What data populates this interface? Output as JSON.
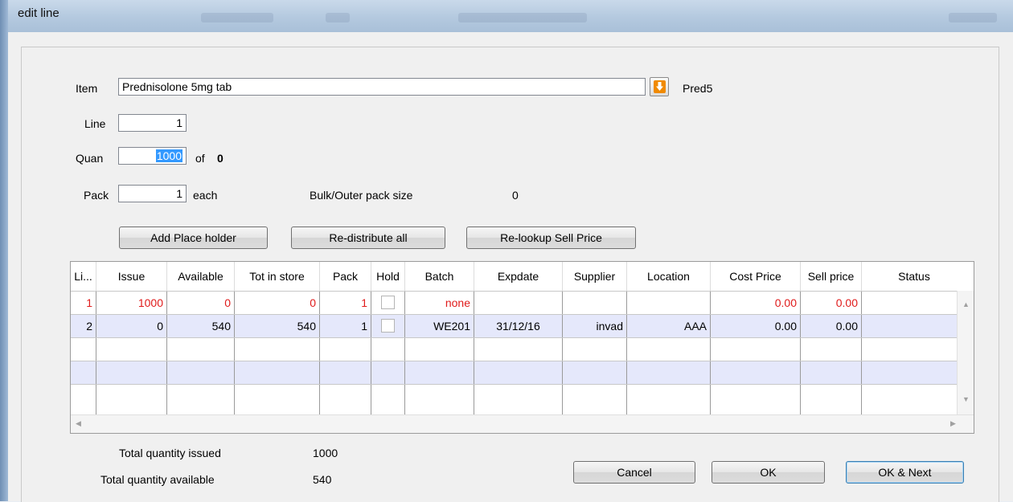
{
  "window": {
    "title": "edit line"
  },
  "form": {
    "item_label": "Item",
    "item_value": "Prednisolone 5mg tab",
    "item_code": "Pred5",
    "line_label": "Line",
    "line_value": "1",
    "quan_label": "Quan",
    "quan_value": "1000",
    "of_label": "of",
    "of_value": "0",
    "pack_label": "Pack",
    "pack_value": "1",
    "pack_unit": "each",
    "bulk_label": "Bulk/Outer pack size",
    "bulk_value": "0"
  },
  "buttons": {
    "add_placeholder": "Add Place holder",
    "redistribute": "Re-distribute all",
    "relookup": "Re-lookup Sell Price",
    "cancel": "Cancel",
    "ok": "OK",
    "ok_next": "OK & Next"
  },
  "table": {
    "columns": [
      "Li...",
      "Issue",
      "Available",
      "Tot in store",
      "Pack",
      "Hold",
      "Batch",
      "Expdate",
      "Supplier",
      "Location",
      "Cost Price",
      "Sell price",
      "Status"
    ],
    "rows": [
      {
        "line": "1",
        "issue": "1000",
        "available": "0",
        "tot": "0",
        "pack": "1",
        "hold": false,
        "batch": "none",
        "expdate": "",
        "supplier": "",
        "location": "",
        "cost": "0.00",
        "sell": "0.00",
        "status": ""
      },
      {
        "line": "2",
        "issue": "0",
        "available": "540",
        "tot": "540",
        "pack": "1",
        "hold": false,
        "batch": "WE201",
        "expdate": "31/12/16",
        "supplier": "invad",
        "location": "AAA",
        "cost": "0.00",
        "sell": "0.00",
        "status": ""
      }
    ]
  },
  "totals": {
    "issued_label": "Total quantity issued",
    "issued_value": "1000",
    "available_label": "Total quantity available",
    "available_value": "540"
  },
  "colors": {
    "error_text": "#e01b1b",
    "alt_row": "#e5e8fb",
    "selection": "#3399ff",
    "arrow_icon": "#f08a00"
  },
  "icons": {
    "lookup": "arrow-down-icon",
    "scroll_up": "scroll-up-icon",
    "scroll_down": "scroll-down-icon",
    "scroll_left": "scroll-left-icon",
    "scroll_right": "scroll-right-icon"
  }
}
